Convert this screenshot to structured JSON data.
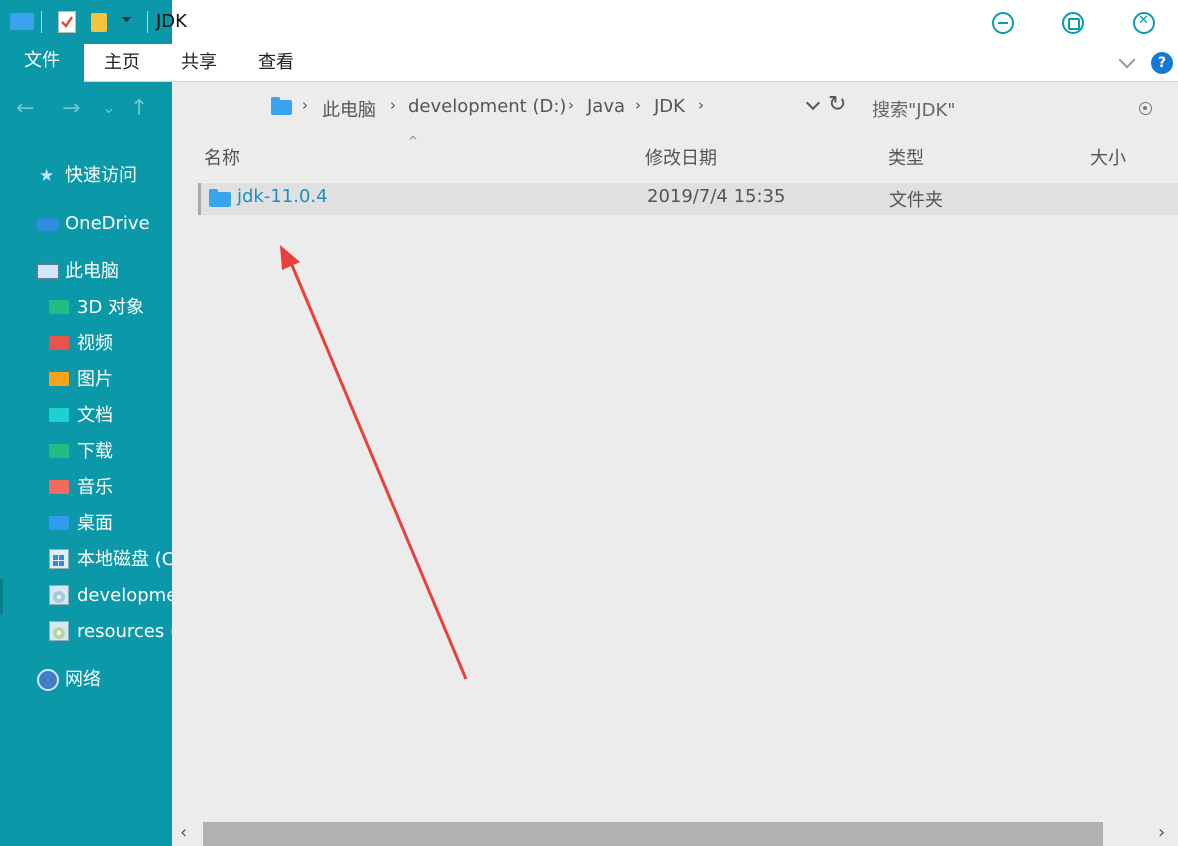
{
  "window": {
    "title": "JDK",
    "accent_color": "#0b98a8"
  },
  "ribbon": {
    "tabs": [
      "文件",
      "主页",
      "共享",
      "查看"
    ],
    "help_label": "?"
  },
  "nav": {
    "back_glyph": "←",
    "forward_glyph": "→",
    "recent_glyph": "⌄",
    "up_glyph": "↑"
  },
  "sidebar": {
    "quick_access": "快速访问",
    "onedrive": "OneDrive",
    "this_pc": "此电脑",
    "items": [
      {
        "label": "3D 对象",
        "icon": "3d-objects-icon",
        "color": "#1fbf83"
      },
      {
        "label": "视频",
        "icon": "videos-icon",
        "color": "#e8534a"
      },
      {
        "label": "图片",
        "icon": "pictures-icon",
        "color": "#f7a21b"
      },
      {
        "label": "文档",
        "icon": "documents-icon",
        "color": "#1ed1d1"
      },
      {
        "label": "下载",
        "icon": "downloads-icon",
        "color": "#1fbf83"
      },
      {
        "label": "音乐",
        "icon": "music-icon",
        "color": "#f06a5e"
      },
      {
        "label": "桌面",
        "icon": "desktop-icon",
        "color": "#2f9cf0"
      },
      {
        "label": "本地磁盘 (C",
        "icon": "windows-drive-icon",
        "color": "#e4eef4"
      },
      {
        "label": "developme",
        "icon": "disc-drive-icon",
        "color": "#d8e8f0"
      },
      {
        "label": "resources (",
        "icon": "disc-drive-icon",
        "color": "#d8e8f0"
      }
    ],
    "network": "网络"
  },
  "address": {
    "crumbs": [
      "此电脑",
      "development (D:)",
      "Java",
      "JDK"
    ],
    "separator": "›",
    "refresh_glyph": "↻",
    "search_placeholder": "搜索\"JDK\""
  },
  "columns": {
    "name": "名称",
    "date": "修改日期",
    "type": "类型",
    "size": "大小",
    "sort_glyph": "^"
  },
  "files": [
    {
      "name": "jdk-11.0.4",
      "modified": "2019/7/4 15:35",
      "type": "文件夹",
      "size": ""
    }
  ],
  "scrollbar": {
    "left_glyph": "‹",
    "right_glyph": "›"
  }
}
